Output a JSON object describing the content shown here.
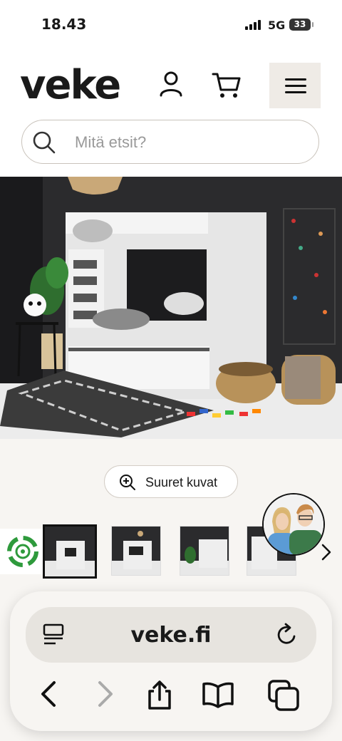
{
  "status_bar": {
    "time": "18.43",
    "network": "5G",
    "battery": "33"
  },
  "header": {
    "logo": "veke",
    "search_placeholder": "Mitä etsit?"
  },
  "product": {
    "zoom_label": "Suuret kuvat",
    "thumbnail_count": 4
  },
  "browser": {
    "url": "veke.fi"
  },
  "colors": {
    "accent_bg": "#efebe6",
    "page_bg": "#f7f5f2",
    "eco_green": "#2e9a3c",
    "shirt_green": "#3c7a4a",
    "shirt_blue": "#5b9bd5"
  },
  "icons": [
    "user-icon",
    "cart-icon",
    "menu-icon",
    "search-icon",
    "zoom-in-icon",
    "chevron-right-icon",
    "eco-badge-icon",
    "reader-icon",
    "reload-icon",
    "back-icon",
    "forward-icon",
    "share-icon",
    "bookmarks-icon",
    "tabs-icon"
  ]
}
